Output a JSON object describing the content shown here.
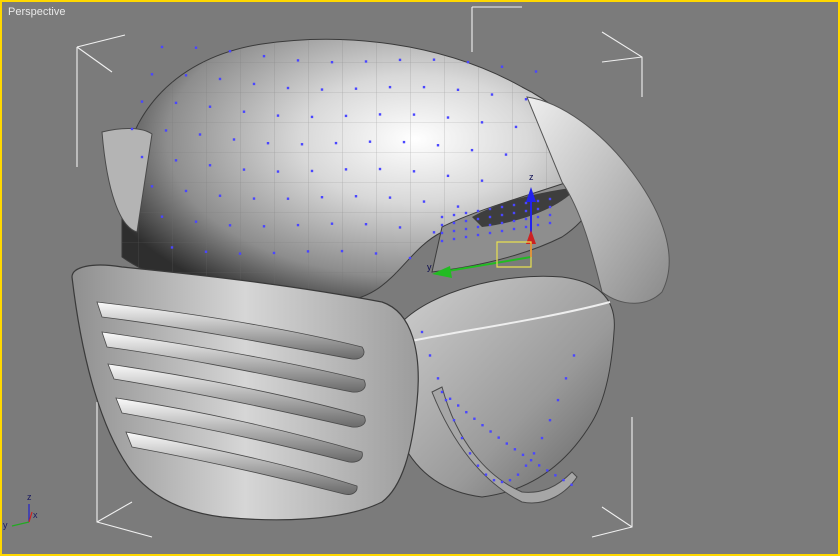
{
  "viewport": {
    "label": "Perspective",
    "border_color": "#ffd800",
    "background": "#7b7b7b"
  },
  "gizmo": {
    "z_label": "z",
    "y_label": "y",
    "colors": {
      "x": "#cc2222",
      "y": "#22bb22",
      "z": "#2222ee",
      "plane": "#e8e050"
    }
  },
  "axis_tripod": {
    "z_label": "z",
    "x_label": "x",
    "y_label": "y"
  },
  "vertex_color": "#4a46ff",
  "bounding_box_color": "#f0f0f0"
}
